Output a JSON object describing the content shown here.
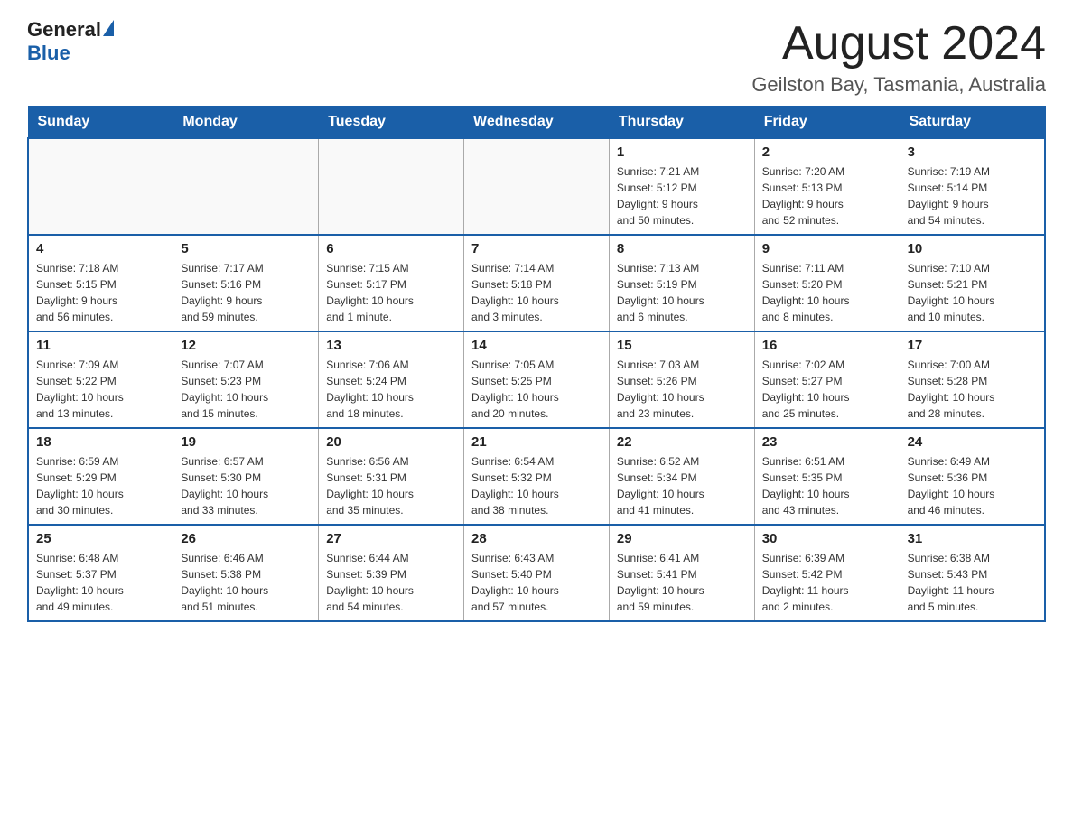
{
  "header": {
    "logo_general": "General",
    "logo_blue": "Blue",
    "month_title": "August 2024",
    "location": "Geilston Bay, Tasmania, Australia"
  },
  "days_of_week": [
    "Sunday",
    "Monday",
    "Tuesday",
    "Wednesday",
    "Thursday",
    "Friday",
    "Saturday"
  ],
  "weeks": [
    [
      {
        "day": "",
        "info": ""
      },
      {
        "day": "",
        "info": ""
      },
      {
        "day": "",
        "info": ""
      },
      {
        "day": "",
        "info": ""
      },
      {
        "day": "1",
        "info": "Sunrise: 7:21 AM\nSunset: 5:12 PM\nDaylight: 9 hours\nand 50 minutes."
      },
      {
        "day": "2",
        "info": "Sunrise: 7:20 AM\nSunset: 5:13 PM\nDaylight: 9 hours\nand 52 minutes."
      },
      {
        "day": "3",
        "info": "Sunrise: 7:19 AM\nSunset: 5:14 PM\nDaylight: 9 hours\nand 54 minutes."
      }
    ],
    [
      {
        "day": "4",
        "info": "Sunrise: 7:18 AM\nSunset: 5:15 PM\nDaylight: 9 hours\nand 56 minutes."
      },
      {
        "day": "5",
        "info": "Sunrise: 7:17 AM\nSunset: 5:16 PM\nDaylight: 9 hours\nand 59 minutes."
      },
      {
        "day": "6",
        "info": "Sunrise: 7:15 AM\nSunset: 5:17 PM\nDaylight: 10 hours\nand 1 minute."
      },
      {
        "day": "7",
        "info": "Sunrise: 7:14 AM\nSunset: 5:18 PM\nDaylight: 10 hours\nand 3 minutes."
      },
      {
        "day": "8",
        "info": "Sunrise: 7:13 AM\nSunset: 5:19 PM\nDaylight: 10 hours\nand 6 minutes."
      },
      {
        "day": "9",
        "info": "Sunrise: 7:11 AM\nSunset: 5:20 PM\nDaylight: 10 hours\nand 8 minutes."
      },
      {
        "day": "10",
        "info": "Sunrise: 7:10 AM\nSunset: 5:21 PM\nDaylight: 10 hours\nand 10 minutes."
      }
    ],
    [
      {
        "day": "11",
        "info": "Sunrise: 7:09 AM\nSunset: 5:22 PM\nDaylight: 10 hours\nand 13 minutes."
      },
      {
        "day": "12",
        "info": "Sunrise: 7:07 AM\nSunset: 5:23 PM\nDaylight: 10 hours\nand 15 minutes."
      },
      {
        "day": "13",
        "info": "Sunrise: 7:06 AM\nSunset: 5:24 PM\nDaylight: 10 hours\nand 18 minutes."
      },
      {
        "day": "14",
        "info": "Sunrise: 7:05 AM\nSunset: 5:25 PM\nDaylight: 10 hours\nand 20 minutes."
      },
      {
        "day": "15",
        "info": "Sunrise: 7:03 AM\nSunset: 5:26 PM\nDaylight: 10 hours\nand 23 minutes."
      },
      {
        "day": "16",
        "info": "Sunrise: 7:02 AM\nSunset: 5:27 PM\nDaylight: 10 hours\nand 25 minutes."
      },
      {
        "day": "17",
        "info": "Sunrise: 7:00 AM\nSunset: 5:28 PM\nDaylight: 10 hours\nand 28 minutes."
      }
    ],
    [
      {
        "day": "18",
        "info": "Sunrise: 6:59 AM\nSunset: 5:29 PM\nDaylight: 10 hours\nand 30 minutes."
      },
      {
        "day": "19",
        "info": "Sunrise: 6:57 AM\nSunset: 5:30 PM\nDaylight: 10 hours\nand 33 minutes."
      },
      {
        "day": "20",
        "info": "Sunrise: 6:56 AM\nSunset: 5:31 PM\nDaylight: 10 hours\nand 35 minutes."
      },
      {
        "day": "21",
        "info": "Sunrise: 6:54 AM\nSunset: 5:32 PM\nDaylight: 10 hours\nand 38 minutes."
      },
      {
        "day": "22",
        "info": "Sunrise: 6:52 AM\nSunset: 5:34 PM\nDaylight: 10 hours\nand 41 minutes."
      },
      {
        "day": "23",
        "info": "Sunrise: 6:51 AM\nSunset: 5:35 PM\nDaylight: 10 hours\nand 43 minutes."
      },
      {
        "day": "24",
        "info": "Sunrise: 6:49 AM\nSunset: 5:36 PM\nDaylight: 10 hours\nand 46 minutes."
      }
    ],
    [
      {
        "day": "25",
        "info": "Sunrise: 6:48 AM\nSunset: 5:37 PM\nDaylight: 10 hours\nand 49 minutes."
      },
      {
        "day": "26",
        "info": "Sunrise: 6:46 AM\nSunset: 5:38 PM\nDaylight: 10 hours\nand 51 minutes."
      },
      {
        "day": "27",
        "info": "Sunrise: 6:44 AM\nSunset: 5:39 PM\nDaylight: 10 hours\nand 54 minutes."
      },
      {
        "day": "28",
        "info": "Sunrise: 6:43 AM\nSunset: 5:40 PM\nDaylight: 10 hours\nand 57 minutes."
      },
      {
        "day": "29",
        "info": "Sunrise: 6:41 AM\nSunset: 5:41 PM\nDaylight: 10 hours\nand 59 minutes."
      },
      {
        "day": "30",
        "info": "Sunrise: 6:39 AM\nSunset: 5:42 PM\nDaylight: 11 hours\nand 2 minutes."
      },
      {
        "day": "31",
        "info": "Sunrise: 6:38 AM\nSunset: 5:43 PM\nDaylight: 11 hours\nand 5 minutes."
      }
    ]
  ]
}
